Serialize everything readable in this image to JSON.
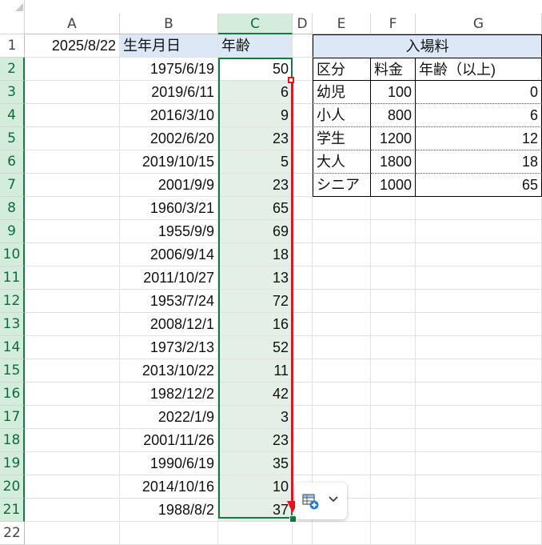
{
  "columns": [
    "A",
    "B",
    "C",
    "D",
    "E",
    "F",
    "G"
  ],
  "rows": [
    "1",
    "2",
    "3",
    "4",
    "5",
    "6",
    "7",
    "8",
    "9",
    "10",
    "11",
    "12",
    "13",
    "14",
    "15",
    "16",
    "17",
    "18",
    "19",
    "20",
    "21",
    "22"
  ],
  "selected_column": "C",
  "cells": {
    "A1": "2025/8/22",
    "B1": "生年月日",
    "C1": "年齢"
  },
  "birthdates": [
    "1975/6/19",
    "2019/6/11",
    "2016/3/10",
    "2002/6/20",
    "2019/10/15",
    "2001/9/9",
    "1960/3/21",
    "1955/9/9",
    "2006/9/14",
    "2011/10/27",
    "1953/7/24",
    "2008/12/1",
    "1973/2/13",
    "2013/10/22",
    "1982/12/2",
    "2022/1/9",
    "2001/11/26",
    "1990/6/19",
    "2014/10/16",
    "1988/8/2"
  ],
  "ages": [
    "50",
    "6",
    "9",
    "23",
    "5",
    "23",
    "65",
    "69",
    "18",
    "13",
    "72",
    "16",
    "52",
    "11",
    "42",
    "3",
    "23",
    "35",
    "10",
    "37"
  ],
  "fee_table": {
    "title": "入場料",
    "headers": [
      "区分",
      "料金",
      "年齢（以上)"
    ],
    "rows": [
      [
        "幼児",
        "100",
        "0"
      ],
      [
        "小人",
        "800",
        "6"
      ],
      [
        "学生",
        "1200",
        "12"
      ],
      [
        "大人",
        "1800",
        "18"
      ],
      [
        "シニア",
        "1000",
        "65"
      ]
    ]
  },
  "quick_analysis": {
    "icon": "quick-analysis-icon",
    "chevron": "chevron-down-icon"
  },
  "colors": {
    "accent": "#107c41",
    "annotation": "#e8141a",
    "header_fill": "#dde8f6"
  }
}
